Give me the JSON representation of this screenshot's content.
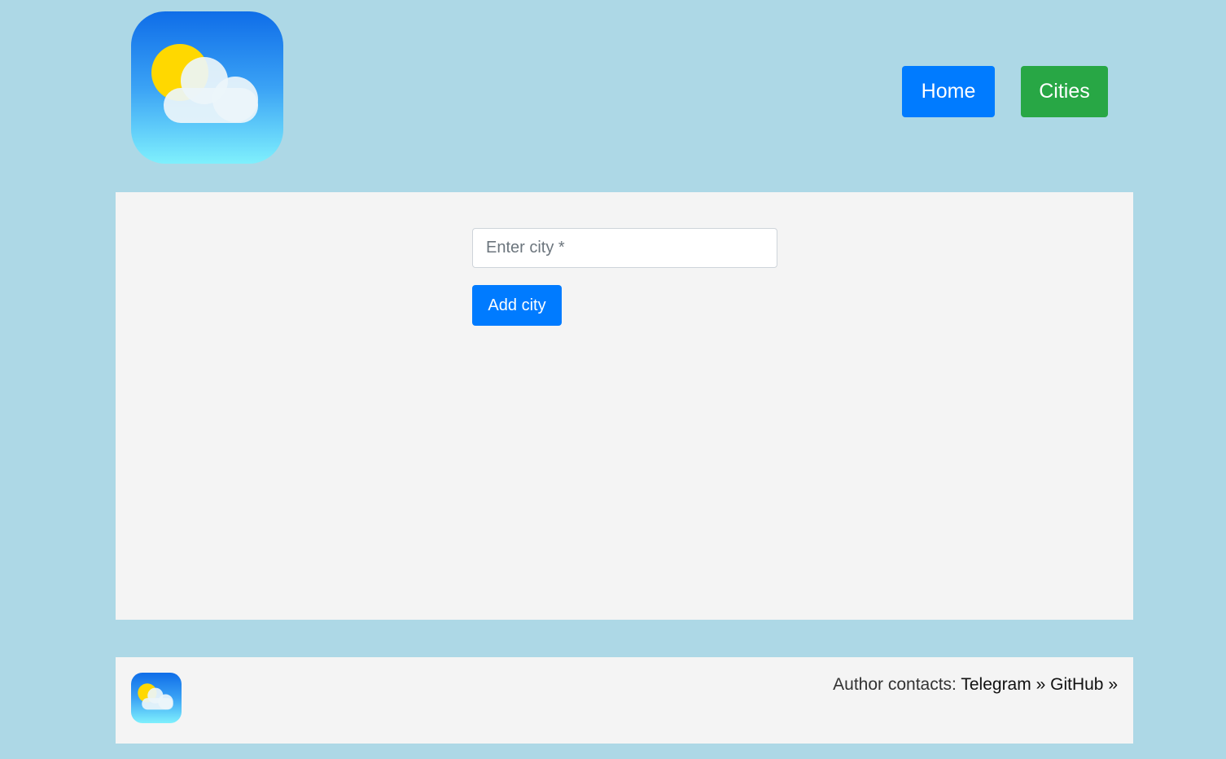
{
  "header": {
    "logo_icon": "weather-sun-cloud-icon",
    "nav": {
      "home_label": "Home",
      "cities_label": "Cities"
    }
  },
  "main": {
    "city_input": {
      "placeholder": "Enter city *",
      "value": ""
    },
    "add_button_label": "Add city"
  },
  "footer": {
    "logo_icon": "weather-sun-cloud-icon",
    "contacts_label": "Author contacts:",
    "telegram_label": "Telegram",
    "telegram_arrow": "»",
    "github_label": "GitHub",
    "github_arrow": "»"
  },
  "colors": {
    "page_background": "#add8e6",
    "panel_background": "#f4f4f4",
    "primary_blue": "#007bff",
    "success_green": "#28a745"
  }
}
